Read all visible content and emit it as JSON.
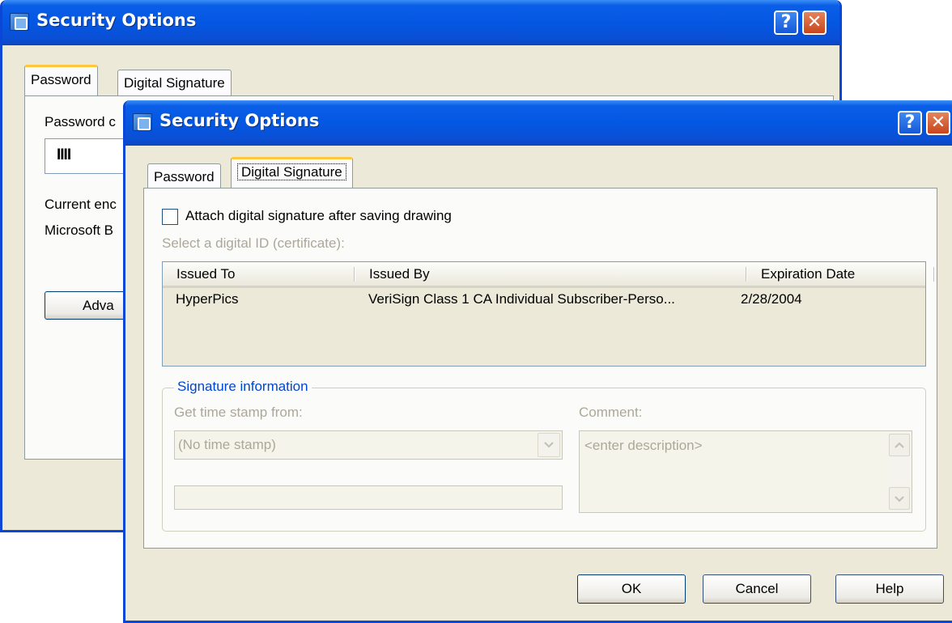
{
  "back_window": {
    "title": "Security Options",
    "help_glyph": "?",
    "close_glyph": "✕",
    "tabs": [
      "Password",
      "Digital Signature"
    ],
    "password_label": "Password c",
    "password_value": "IIII",
    "current_enc_label": "Current enc",
    "provider_label": "Microsoft B",
    "advanced_button": "Adva"
  },
  "front_window": {
    "title": "Security Options",
    "help_glyph": "?",
    "close_glyph": "✕",
    "tabs": [
      "Password",
      "Digital Signature"
    ],
    "attach_checkbox_label": "Attach digital signature after saving drawing",
    "attach_checkbox_checked": false,
    "select_id_label": "Select a digital ID (certificate):",
    "columns": [
      "Issued To",
      "Issued By",
      "Expiration Date"
    ],
    "rows": [
      {
        "issued_to": "HyperPics",
        "issued_by": "VeriSign Class 1 CA Individual Subscriber-Perso...",
        "expiration": "2/28/2004"
      }
    ],
    "signature_group_title": "Signature information",
    "timestamp_label": "Get time stamp from:",
    "timestamp_value": "(No time stamp)",
    "comment_label": "Comment:",
    "comment_placeholder": "<enter description>",
    "buttons": {
      "ok": "OK",
      "cancel": "Cancel",
      "help": "Help"
    }
  },
  "colors": {
    "titlebar": "#0457e3",
    "window_bg": "#ece9d8",
    "group_title": "#0046d5",
    "disabled_text": "#aca899"
  },
  "icons": [
    "app-icon",
    "help-icon",
    "close-icon",
    "chevron-down-icon",
    "chevron-up-icon"
  ]
}
